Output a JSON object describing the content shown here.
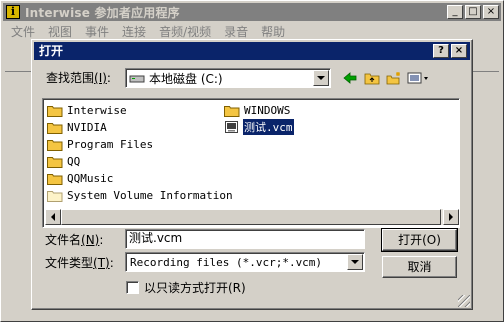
{
  "app": {
    "title": "Interwise 参加者应用程序",
    "icon_letter": "i",
    "menu": [
      "文件",
      "视图",
      "事件",
      "连接",
      "音频/视频",
      "录音",
      "帮助"
    ],
    "window_buttons": {
      "minimize": "_",
      "maximize": "□",
      "close": "×"
    }
  },
  "dialog": {
    "title": "打开",
    "help_button": "?",
    "close_button": "×",
    "look_in": {
      "label": "查找范围",
      "accel": "(I)",
      "value": "本地磁盘 (C:)"
    },
    "files": [
      {
        "name": "Interwise",
        "type": "folder"
      },
      {
        "name": "NVIDIA",
        "type": "folder"
      },
      {
        "name": "Program Files",
        "type": "folder"
      },
      {
        "name": "QQ",
        "type": "folder"
      },
      {
        "name": "QQMusic",
        "type": "folder"
      },
      {
        "name": "System Volume Information",
        "type": "folder"
      },
      {
        "name": "WINDOWS",
        "type": "folder"
      },
      {
        "name": "测试.vcm",
        "type": "file",
        "selected": true
      }
    ],
    "filename": {
      "label": "文件名",
      "accel": "(N)",
      "value": "测试.vcm"
    },
    "filetype": {
      "label": "文件类型",
      "accel": "(T)",
      "value": "Recording files (*.vcr;*.vcm)"
    },
    "open_button": "打开(O)",
    "cancel_button": "取消",
    "readonly": {
      "label": "以只读方式打开(R)",
      "checked": false
    }
  },
  "colors": {
    "active_title": "#0a246a",
    "inactive_title": "#808080",
    "face": "#d4d0c8",
    "folder": "#f4c542"
  }
}
